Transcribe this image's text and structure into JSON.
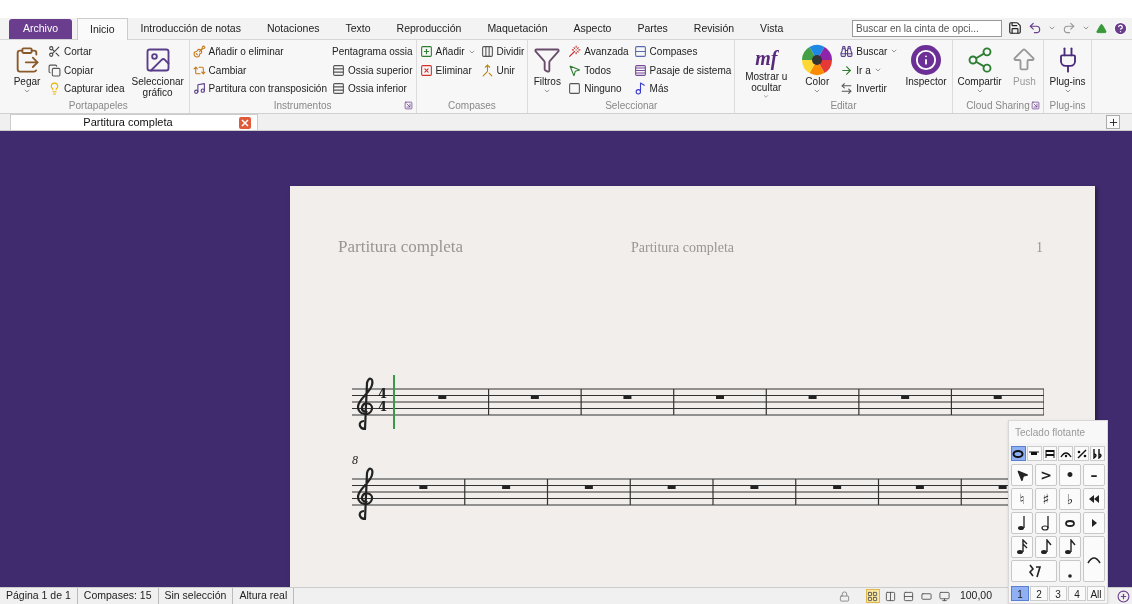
{
  "ribbon_tabs": [
    {
      "label": "Archivo",
      "kind": "file",
      "selected": false
    },
    {
      "label": "Inicio",
      "kind": "tab",
      "selected": true
    },
    {
      "label": "Introducción de notas",
      "kind": "tab",
      "selected": false
    },
    {
      "label": "Notaciones",
      "kind": "tab",
      "selected": false
    },
    {
      "label": "Texto",
      "kind": "tab",
      "selected": false
    },
    {
      "label": "Reproducción",
      "kind": "tab",
      "selected": false
    },
    {
      "label": "Maquetación",
      "kind": "tab",
      "selected": false
    },
    {
      "label": "Aspecto",
      "kind": "tab",
      "selected": false
    },
    {
      "label": "Partes",
      "kind": "tab",
      "selected": false
    },
    {
      "label": "Revisión",
      "kind": "tab",
      "selected": false
    },
    {
      "label": "Vista",
      "kind": "tab",
      "selected": false
    }
  ],
  "ribbon_search": {
    "placeholder": "Buscar en la cinta de opci..."
  },
  "ribbon_groups": [
    {
      "label": "Portapapeles",
      "launcher": false,
      "columns": [
        [
          {
            "kind": "large",
            "label": "Pegar",
            "dropdown": true
          }
        ],
        [
          {
            "kind": "small",
            "label": "Cortar"
          },
          {
            "kind": "small",
            "label": "Copiar"
          },
          {
            "kind": "small",
            "label": "Capturar idea"
          }
        ],
        [
          {
            "kind": "large",
            "label": "Seleccionar gráfico"
          }
        ]
      ]
    },
    {
      "label": "Instrumentos",
      "launcher": true,
      "columns": [
        [
          {
            "kind": "small",
            "label": "Añadir o eliminar"
          },
          {
            "kind": "small",
            "label": "Cambiar"
          },
          {
            "kind": "small",
            "label": "Partitura con transposición"
          }
        ],
        [
          {
            "kind": "small",
            "label": "Pentagrama ossia"
          },
          {
            "kind": "small",
            "label": "Ossia superior"
          },
          {
            "kind": "small",
            "label": "Ossia inferior"
          }
        ]
      ]
    },
    {
      "label": "Compases",
      "launcher": false,
      "columns": [
        [
          {
            "kind": "small",
            "label": "Añadir",
            "dropdown": true
          },
          {
            "kind": "small",
            "label": "Eliminar"
          }
        ],
        [
          {
            "kind": "small",
            "label": "Dividir"
          },
          {
            "kind": "small",
            "label": "Unir"
          }
        ]
      ]
    },
    {
      "label": "Seleccionar",
      "launcher": false,
      "columns": [
        [
          {
            "kind": "large",
            "label": "Filtros",
            "dropdown": true
          }
        ],
        [
          {
            "kind": "small",
            "label": "Avanzada"
          },
          {
            "kind": "small",
            "label": "Todos"
          },
          {
            "kind": "small",
            "label": "Ninguno"
          }
        ],
        [
          {
            "kind": "small",
            "label": "Compases"
          },
          {
            "kind": "small",
            "label": "Pasaje de sistema"
          },
          {
            "kind": "small",
            "label": "Más"
          }
        ]
      ]
    },
    {
      "label": "Editar",
      "launcher": false,
      "columns": [
        [
          {
            "kind": "large",
            "label": "Mostrar u ocultar",
            "glyph": "mf",
            "dropdown": true
          }
        ],
        [
          {
            "kind": "large",
            "label": "Color",
            "dropdown": true
          }
        ],
        [
          {
            "kind": "small",
            "label": "Buscar",
            "dropdown": true
          },
          {
            "kind": "small",
            "label": "Ir a",
            "dropdown": true
          },
          {
            "kind": "small",
            "label": "Invertir"
          }
        ],
        [
          {
            "kind": "large",
            "label": "Inspector"
          }
        ]
      ]
    },
    {
      "label": "Cloud Sharing",
      "launcher": true,
      "columns": [
        [
          {
            "kind": "large",
            "label": "Compartir",
            "dropdown": true
          }
        ],
        [
          {
            "kind": "large",
            "label": "Push",
            "disabled": true
          }
        ]
      ]
    },
    {
      "label": "Plug-ins",
      "launcher": false,
      "columns": [
        [
          {
            "kind": "large",
            "label": "Plug-ins",
            "dropdown": true
          }
        ]
      ]
    }
  ],
  "document_tabs": [
    {
      "label": "Partitura completa",
      "selected": true
    }
  ],
  "score": {
    "header_left": "Partitura completa",
    "header_center": "Partitura completa",
    "page_number": "1",
    "systems": [
      {
        "time_signature": [
          "4",
          "4"
        ],
        "cursor": true,
        "measures": [
          {
            "kind": "rest"
          },
          {
            "kind": "rest"
          },
          {
            "kind": "rest"
          },
          {
            "kind": "rest"
          },
          {
            "kind": "rest"
          },
          {
            "kind": "rest"
          },
          {
            "kind": "rest"
          }
        ]
      },
      {
        "measure_number": "8",
        "cursor": false,
        "measures": [
          {
            "kind": "rest"
          },
          {
            "kind": "rest"
          },
          {
            "kind": "rest"
          },
          {
            "kind": "rest"
          },
          {
            "kind": "rest"
          },
          {
            "kind": "rest"
          },
          {
            "kind": "rest"
          },
          {
            "kind": "rest"
          }
        ]
      }
    ]
  },
  "keypad": {
    "title": "Teclado flotante",
    "modes": [
      {
        "kind": "notes",
        "selected": true
      },
      {
        "kind": "rest",
        "selected": false
      },
      {
        "kind": "beams",
        "selected": false
      },
      {
        "kind": "fermata",
        "selected": false
      },
      {
        "kind": "repeat",
        "selected": false
      },
      {
        "kind": "accidentals",
        "selected": false
      }
    ],
    "keys": [
      {
        "kind": "pointer"
      },
      {
        "kind": "text",
        "label": ">"
      },
      {
        "kind": "text",
        "label": "•"
      },
      {
        "kind": "text",
        "label": "–"
      },
      {
        "kind": "text",
        "label": "♮"
      },
      {
        "kind": "text",
        "label": "♯"
      },
      {
        "kind": "text",
        "label": "♭"
      },
      {
        "kind": "rewind"
      },
      {
        "kind": "quarter"
      },
      {
        "kind": "half"
      },
      {
        "kind": "whole"
      },
      {
        "kind": "play"
      },
      {
        "kind": "sixteenth"
      },
      {
        "kind": "eighth"
      },
      {
        "kind": "eighth"
      },
      {
        "kind": "tie"
      },
      {
        "kind": "rests"
      },
      {
        "kind": "dot"
      }
    ],
    "layouts": [
      {
        "label": "1",
        "selected": true
      },
      {
        "label": "2",
        "selected": false
      },
      {
        "label": "3",
        "selected": false
      },
      {
        "label": "4",
        "selected": false
      },
      {
        "label": "All",
        "selected": false
      }
    ]
  },
  "status_bar": {
    "items": [
      "Página 1 de 1",
      "Compases: 15",
      "Sin selección",
      "Altura real"
    ],
    "zoom": "100,00",
    "views": [
      {
        "selected": true
      },
      {
        "selected": false
      },
      {
        "selected": false
      },
      {
        "selected": false
      },
      {
        "selected": false
      }
    ]
  }
}
